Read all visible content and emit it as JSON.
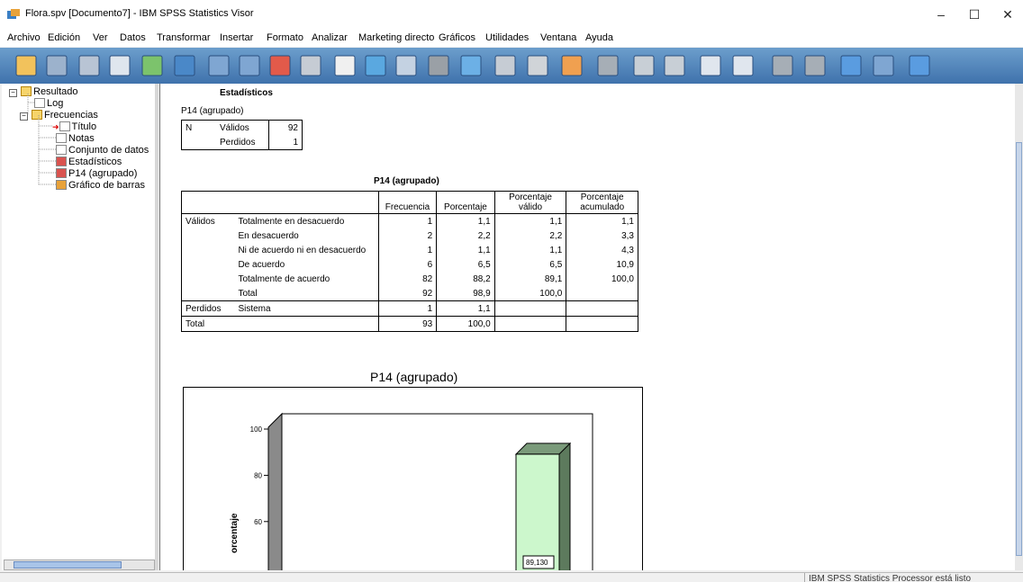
{
  "window": {
    "title": "Flora.spv [Documento7] - IBM SPSS Statistics Visor",
    "minimize": "–",
    "maximize": "☐",
    "close": "✕"
  },
  "menu": [
    "Archivo",
    "Edición",
    "Ver",
    "Datos",
    "Transformar",
    "Insertar",
    "Formato",
    "Analizar",
    "Marketing directo",
    "Gráficos",
    "Utilidades",
    "Ventana",
    "Ayuda"
  ],
  "toolbar_icons": [
    "open-icon",
    "save-icon",
    "print-icon",
    "print-preview-icon",
    "export-icon",
    "recall-dialog-icon",
    "undo-icon",
    "redo-icon",
    "goto-data-icon",
    "goto-case-icon",
    "goto-variable-icon",
    "variables-icon",
    "show-all-icon",
    "hide-icon",
    "split-file-icon",
    "weight-cases-icon",
    "select-cases-icon",
    "value-labels-icon",
    "insert-output-icon",
    "promote-icon",
    "demote-icon",
    "expand-icon",
    "collapse-icon",
    "show-icon",
    "hide-output-icon",
    "insert-heading-icon",
    "insert-title-icon",
    "insert-text-icon"
  ],
  "tree": {
    "root": "Resultado",
    "log": "Log",
    "group": "Frecuencias",
    "items": [
      "Título",
      "Notas",
      "Conjunto de datos",
      "Estadísticos",
      "P14 (agrupado)",
      "Gráfico de barras"
    ]
  },
  "stats_table": {
    "title": "Estadísticos",
    "subtitle": "P14 (agrupado)",
    "n_label": "N",
    "rows": [
      {
        "label": "Válidos",
        "value": "92"
      },
      {
        "label": "Perdidos",
        "value": "1"
      }
    ]
  },
  "freq_table": {
    "title": "P14 (agrupado)",
    "headers": [
      "Frecuencia",
      "Porcentaje",
      "Porcentaje válido",
      "Porcentaje acumulado"
    ],
    "group_valid": "Válidos",
    "group_missing": "Perdidos",
    "rows": [
      {
        "label": "Totalmente en desacuerdo",
        "freq": "1",
        "pct": "1,1",
        "valid": "1,1",
        "cum": "1,1"
      },
      {
        "label": "En desacuerdo",
        "freq": "2",
        "pct": "2,2",
        "valid": "2,2",
        "cum": "3,3"
      },
      {
        "label": "Ni de acuerdo ni en desacuerdo",
        "freq": "1",
        "pct": "1,1",
        "valid": "1,1",
        "cum": "4,3"
      },
      {
        "label": "De acuerdo",
        "freq": "6",
        "pct": "6,5",
        "valid": "6,5",
        "cum": "10,9"
      },
      {
        "label": "Totalmente de acuerdo",
        "freq": "82",
        "pct": "88,2",
        "valid": "89,1",
        "cum": "100,0"
      },
      {
        "label": "Total",
        "freq": "92",
        "pct": "98,9",
        "valid": "100,0",
        "cum": ""
      }
    ],
    "missing_row": {
      "label": "Sistema",
      "freq": "1",
      "pct": "1,1"
    },
    "total_row": {
      "label": "Total",
      "freq": "93",
      "pct": "100,0"
    }
  },
  "chart_data": {
    "type": "bar",
    "title": "P14 (agrupado)",
    "ylabel": "orcentaje",
    "yticks": [
      60,
      80,
      100
    ],
    "ylim": [
      0,
      110
    ],
    "bar_label": "89,130",
    "values": [
      89.13
    ],
    "bar_color": "#ccf7cc"
  },
  "status": {
    "message": "IBM SPSS Statistics Processor está listo"
  }
}
